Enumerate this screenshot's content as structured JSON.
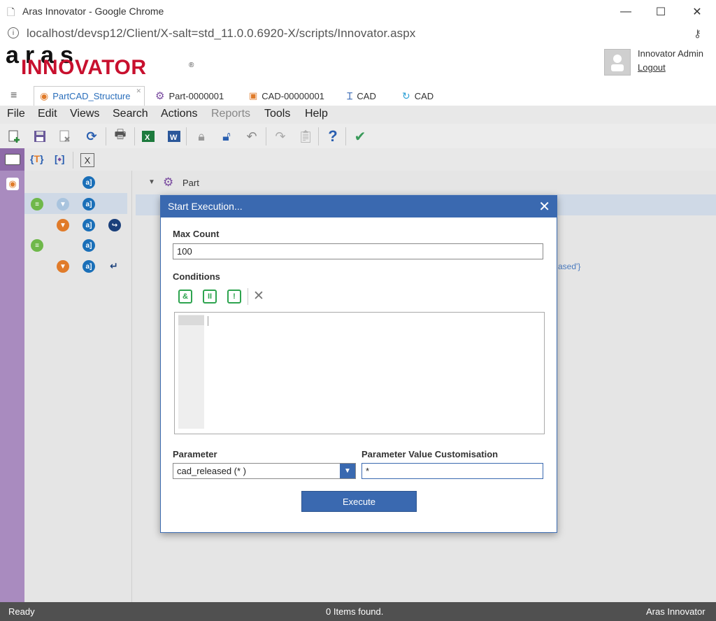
{
  "window": {
    "title": "Aras Innovator - Google Chrome",
    "url": "localhost/devsp12/Client/X-salt=std_11.0.0.6920-X/scripts/Innovator.aspx"
  },
  "header": {
    "logo_top": "aras",
    "logo_bottom": "INNOVATOR",
    "logo_reg": "®",
    "user_name": "Innovator Admin",
    "logout_label": "Logout"
  },
  "tabs": [
    {
      "label": "PartCAD_Structure",
      "icon": "structure-icon",
      "active": true
    },
    {
      "label": "Part-0000001",
      "icon": "gear-icon"
    },
    {
      "label": "CAD-00000001",
      "icon": "cad-doc-icon"
    },
    {
      "label": "CAD",
      "icon": "cad-icon"
    },
    {
      "label": "CAD",
      "icon": "refresh-cad-icon"
    }
  ],
  "menu": {
    "file": "File",
    "edit": "Edit",
    "views": "Views",
    "search": "Search",
    "actions": "Actions",
    "reports": "Reports",
    "tools": "Tools",
    "help": "Help"
  },
  "tree": {
    "root_label": "Part",
    "partial_text": "ased'}"
  },
  "dialog": {
    "title": "Start Execution...",
    "close_glyph": "✕",
    "max_count_label": "Max Count",
    "max_count_value": "100",
    "conditions_label": "Conditions",
    "cond_and": "&",
    "cond_or": "II",
    "cond_not": "!",
    "cond_delete": "✕",
    "parameter_label": "Parameter",
    "parameter_value": "cad_released (* )",
    "param_custom_label": "Parameter Value Customisation",
    "param_custom_value": "*",
    "execute_label": "Execute"
  },
  "status": {
    "left": "Ready",
    "center": "0 Items found.",
    "right": "Aras Innovator"
  },
  "colors": {
    "accent": "#3a69b0",
    "logo_red": "#c8102e",
    "sidebar_purple": "#a98bbf",
    "condition_green": "#2ea44f"
  }
}
